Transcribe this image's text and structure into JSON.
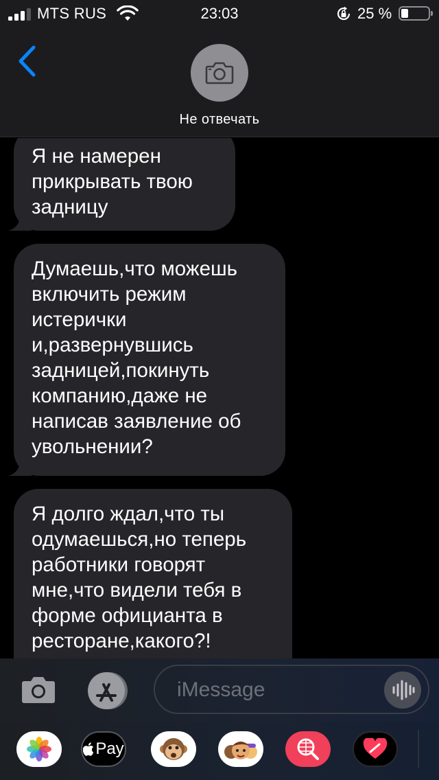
{
  "status_bar": {
    "carrier": "MTS RUS",
    "time": "23:03",
    "battery_percent": "25 %",
    "battery_level": 0.25,
    "signal_bars_filled": 3,
    "icons": [
      "signal-icon",
      "wifi-icon",
      "rotation-lock-icon",
      "battery-icon"
    ]
  },
  "header": {
    "back_icon": "chevron-left-icon",
    "avatar_icon": "camera-icon",
    "contact_name": "Не отвечать"
  },
  "messages": [
    {
      "direction": "incoming",
      "text": "Я не намерен\nприкрывать твою\nзадницу"
    },
    {
      "direction": "incoming",
      "text": "Думаешь,что можешь\nвключить режим\nистерички\nи,развернувшись\nзадницей,покинуть\nкомпанию,даже не\nнаписав заявление об\nувольнении?"
    },
    {
      "direction": "incoming",
      "text": "Я долго ждал,что ты\nодумаешься,но теперь\nработники говорят\nмне,что видели тебя в\nформе официанта в\nресторане,какого?!"
    }
  ],
  "composer": {
    "placeholder": "iMessage",
    "camera_icon": "camera-icon",
    "apps_icon": "app-store-icon",
    "voice_icon": "voice-waveform-icon"
  },
  "app_drawer": [
    {
      "name": "photos-app-icon",
      "label": ""
    },
    {
      "name": "apple-pay-app-icon",
      "label": "Pay"
    },
    {
      "name": "animoji-app-icon",
      "label": ""
    },
    {
      "name": "memoji-app-icon",
      "label": ""
    },
    {
      "name": "web-search-app-icon",
      "label": ""
    },
    {
      "name": "digital-touch-app-icon",
      "label": ""
    }
  ],
  "colors": {
    "bubble_incoming": "#26252a",
    "accent": "#0a84ff",
    "background": "#000000"
  }
}
